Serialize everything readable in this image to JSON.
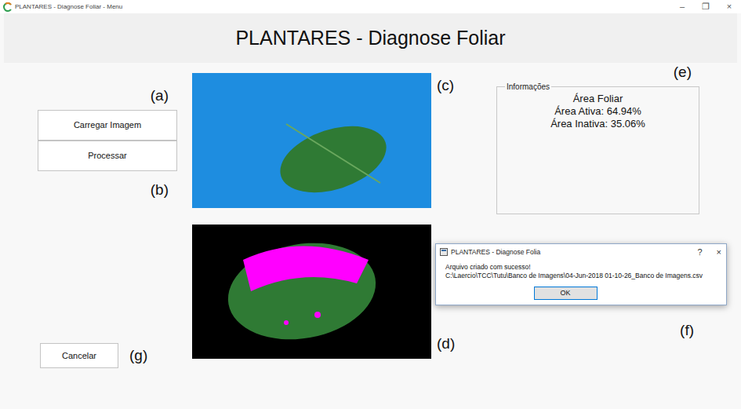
{
  "window": {
    "title": "PLANTARES - Diagnose Foliar - Menu",
    "controls": [
      "–",
      "❐",
      "×"
    ]
  },
  "header": {
    "title": "PLANTARES - Diagnose Foliar"
  },
  "buttons": [
    {
      "label": "Carregar Imagem"
    },
    {
      "label": "Processar"
    }
  ],
  "cancel_button": {
    "label": "Cancelar"
  },
  "labels": {
    "a": "(a)",
    "b": "(b)",
    "c": "(c)",
    "d": "(d)",
    "e": "(e)",
    "f": "(f)",
    "g": "(g)"
  },
  "info": {
    "legend": "Informações",
    "lines": [
      "Área Foliar",
      "Área Ativa: 64.94%",
      "Área Inativa: 35.06%"
    ]
  },
  "dialog": {
    "title": "PLANTARES - Diagnose Folia",
    "controls": [
      "?",
      "×"
    ],
    "message": "Arquivo criado com sucesso!",
    "path": "C:\\Laercio\\TCC\\Tutu\\Banco de Imagens\\04-Jun-2018 01-10-26_Banco de Imagens.csv",
    "button": "OK"
  }
}
